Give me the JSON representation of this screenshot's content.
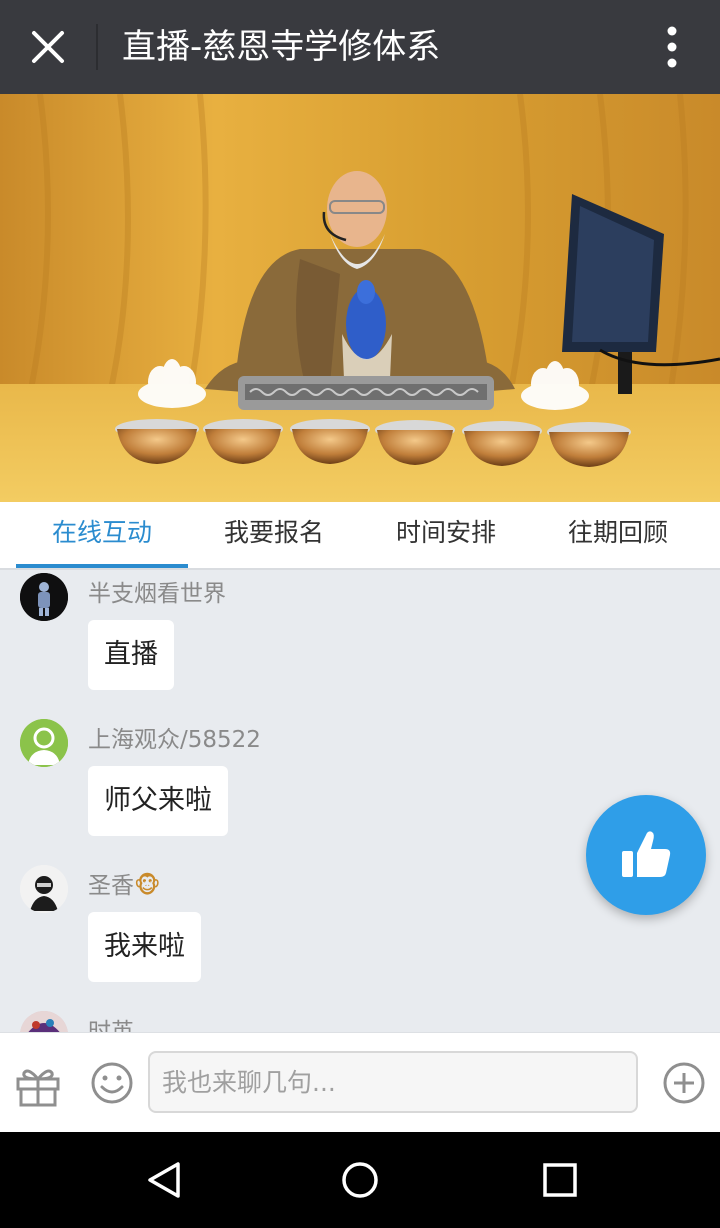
{
  "header": {
    "title": "直播-慈恩寺学修体系",
    "close_icon": "close-icon",
    "more_icon": "more-vertical-icon"
  },
  "tabs": [
    {
      "label": "在线互动",
      "active": true
    },
    {
      "label": "我要报名",
      "active": false
    },
    {
      "label": "时间安排",
      "active": false
    },
    {
      "label": "往期回顾",
      "active": false
    }
  ],
  "messages": [
    {
      "user": "半支烟看世界",
      "text": "直播"
    },
    {
      "user": "上海观众/58522",
      "text": "师父来啦"
    },
    {
      "user": "圣香",
      "text": "我来啦"
    },
    {
      "user": "时英",
      "text": ""
    }
  ],
  "input": {
    "placeholder": "我也来聊几句..."
  },
  "colors": {
    "accent": "#2b8ccf",
    "like_button": "#2f9ee8",
    "topbar": "#393a3f"
  }
}
